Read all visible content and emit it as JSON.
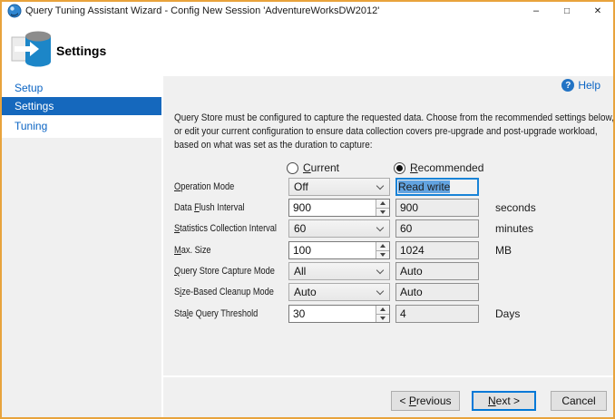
{
  "window": {
    "title": "Query Tuning Assistant Wizard - Config New Session 'AdventureWorksDW2012'",
    "controls": {
      "minimize": "–",
      "maximize": "□",
      "close": "✕"
    }
  },
  "header": {
    "title": "Settings"
  },
  "sidebar": {
    "items": [
      {
        "label": "Setup",
        "selected": false
      },
      {
        "label": "Settings",
        "selected": true
      },
      {
        "label": "Tuning",
        "selected": false
      }
    ]
  },
  "content": {
    "help_icon": "?",
    "help_label": "Help",
    "description_lines": [
      "Query Store must be configured to capture the requested data. Choose from the recommended settings below,",
      "or edit your current configuration to ensure data collection covers pre-upgrade and post-upgrade workload,",
      "based on what was set as the duration to capture:"
    ],
    "radios": {
      "current": {
        "label_pre": "",
        "label_key": "C",
        "label_post": "urrent",
        "selected": false
      },
      "recommended": {
        "label_pre": "",
        "label_key": "R",
        "label_post": "ecommended",
        "selected": true
      }
    },
    "form": {
      "rows": [
        {
          "label_pre": "",
          "label_key": "O",
          "label_post": "peration Mode",
          "control": "combo",
          "current": "Off",
          "recommended": "Read write",
          "unit": ""
        },
        {
          "label_pre": "Data ",
          "label_key": "F",
          "label_post": "lush Interval",
          "control": "spinner",
          "current": "900",
          "recommended": "900",
          "unit": "seconds"
        },
        {
          "label_pre": "",
          "label_key": "S",
          "label_post": "tatistics Collection Interval",
          "control": "combo",
          "current": "60",
          "recommended": "60",
          "unit": "minutes"
        },
        {
          "label_pre": "",
          "label_key": "M",
          "label_post": "ax. Size",
          "control": "spinner",
          "current": "100",
          "recommended": "1024",
          "unit": "MB"
        },
        {
          "label_pre": "",
          "label_key": "Q",
          "label_post": "uery Store Capture Mode",
          "control": "combo",
          "current": "All",
          "recommended": "Auto",
          "unit": ""
        },
        {
          "label_pre": "S",
          "label_key": "i",
          "label_post": "ze-Based Cleanup Mode",
          "control": "combo",
          "current": "Auto",
          "recommended": "Auto",
          "unit": ""
        },
        {
          "label_pre": "Sta",
          "label_key": "l",
          "label_post": "e Query Threshold",
          "control": "spinner",
          "current": "30",
          "recommended": "4",
          "unit": "Days"
        }
      ]
    }
  },
  "footer": {
    "previous": {
      "label_pre": "< ",
      "label_key": "P",
      "label_post": "revious"
    },
    "next": {
      "label_pre": "",
      "label_key": "N",
      "label_post": "ext >"
    },
    "cancel": {
      "label_pre": "Cancel",
      "label_key": "",
      "label_post": ""
    }
  },
  "colors": {
    "window_border": "#E8A33C",
    "accent_blue": "#0078D7",
    "nav_selected_bg": "#1568BD",
    "link_blue": "#0A64C4",
    "selection_bg": "#62A3E0",
    "content_bg": "#F0F0F0",
    "readonly_field_bg": "#ECECEC"
  }
}
